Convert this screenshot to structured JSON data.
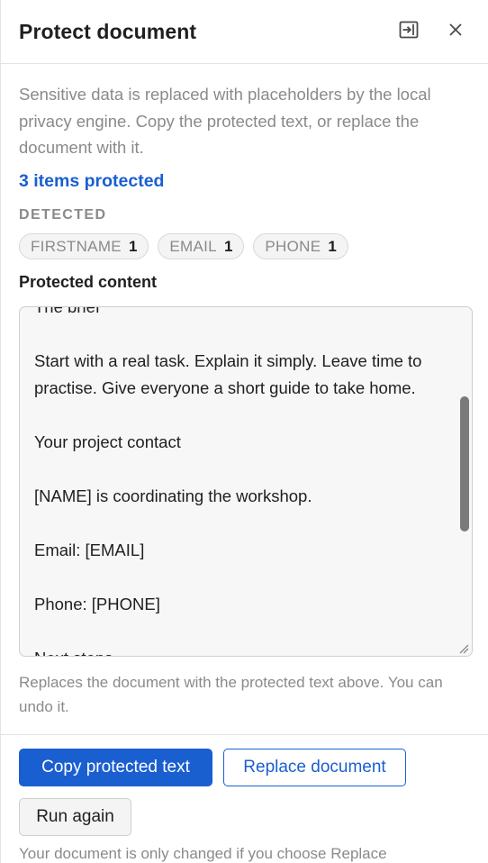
{
  "header": {
    "title": "Protect document",
    "dock_icon": "dock-right-icon",
    "close_icon": "close-icon"
  },
  "description": "Sensitive data is replaced with placeholders by the local privacy engine. Copy the protected text, or replace the document with it.",
  "summary": {
    "protected_count": "3 items protected"
  },
  "detected": {
    "label": "DETECTED",
    "chips": [
      {
        "name": "FIRSTNAME",
        "count": "1"
      },
      {
        "name": "EMAIL",
        "count": "1"
      },
      {
        "name": "PHONE",
        "count": "1"
      }
    ]
  },
  "protected_content": {
    "label": "Protected content",
    "lines": [
      "The brief",
      "",
      "Start with a real task. Explain it simply. Leave time to",
      "practise. Give everyone a short guide to take home.",
      "",
      "Your project contact",
      "",
      "[NAME] is coordinating the workshop.",
      "",
      "Email: [EMAIL]",
      "",
      "Phone: [PHONE]",
      "",
      "Next steps"
    ]
  },
  "hint": "Replaces the document with the protected text above. You can undo it.",
  "actions": {
    "copy_label": "Copy protected text",
    "replace_label": "Replace document",
    "run_again_label": "Run again"
  },
  "footnote": "Your document is only changed if you choose Replace",
  "colors": {
    "accent": "#1a5fd0",
    "muted_text": "#8a8a8a",
    "border": "#e3e3e3"
  }
}
